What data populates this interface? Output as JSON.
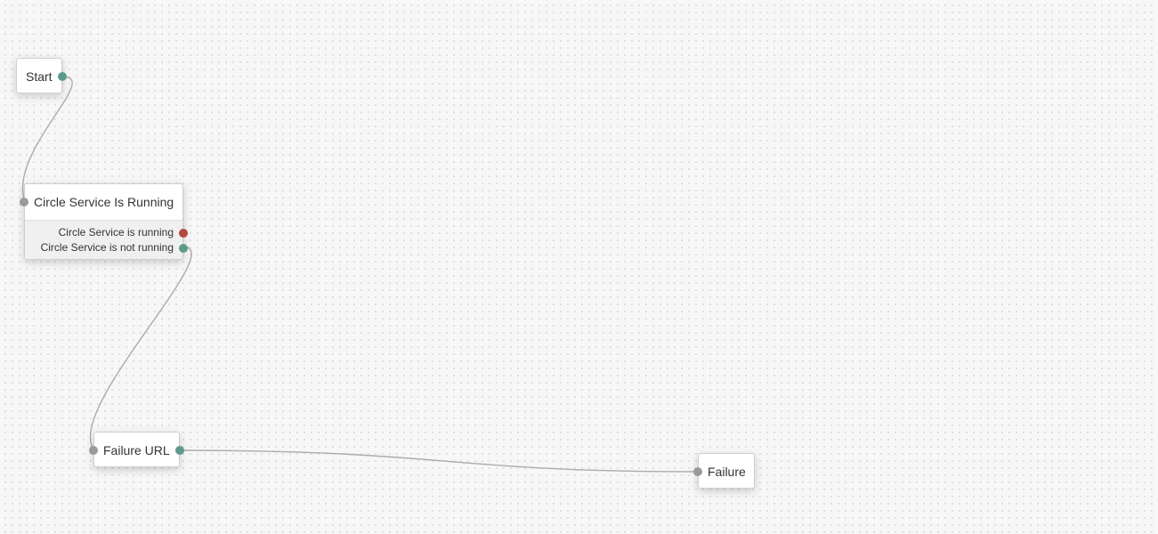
{
  "colors": {
    "background": "#f7f7f7",
    "grid_dot": "#d9d9d9",
    "wire": "#ababab",
    "input_port": "#9a9a9a",
    "output_port_teal": "#5c9a8c",
    "output_port_red": "#b24a40"
  },
  "nodes": {
    "start": {
      "title": "Start"
    },
    "circle_service": {
      "title": "Circle Service Is Running",
      "outputs": [
        {
          "label": "Circle Service is running"
        },
        {
          "label": "Circle Service is not running"
        }
      ]
    },
    "failure_url": {
      "title": "Failure URL"
    },
    "failure": {
      "title": "Failure"
    }
  },
  "connections": [
    {
      "from": "start.out",
      "to": "circle_service.in"
    },
    {
      "from": "circle_service.out_not_running",
      "to": "failure_url.in"
    },
    {
      "from": "failure_url.out",
      "to": "failure.in"
    }
  ]
}
